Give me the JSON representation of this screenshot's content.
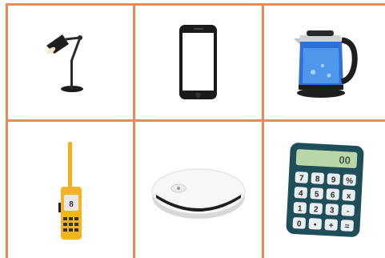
{
  "grid": {
    "line_color": "#ea8a5b",
    "items": [
      {
        "id": "lamp",
        "icon": "desk-lamp-icon"
      },
      {
        "id": "phone",
        "icon": "smartphone-icon"
      },
      {
        "id": "kettle",
        "icon": "electric-kettle-icon"
      },
      {
        "id": "radio",
        "icon": "walkie-talkie-icon"
      },
      {
        "id": "vacuum",
        "icon": "robot-vacuum-icon"
      },
      {
        "id": "calculator",
        "icon": "calculator-icon"
      }
    ]
  },
  "radio": {
    "display": "8"
  },
  "calculator": {
    "display": "00",
    "keys": [
      "7",
      "8",
      "9",
      "%",
      "4",
      "5",
      "6",
      "x",
      "1",
      "2",
      "3",
      "-",
      "0",
      "•",
      "+",
      "="
    ]
  }
}
